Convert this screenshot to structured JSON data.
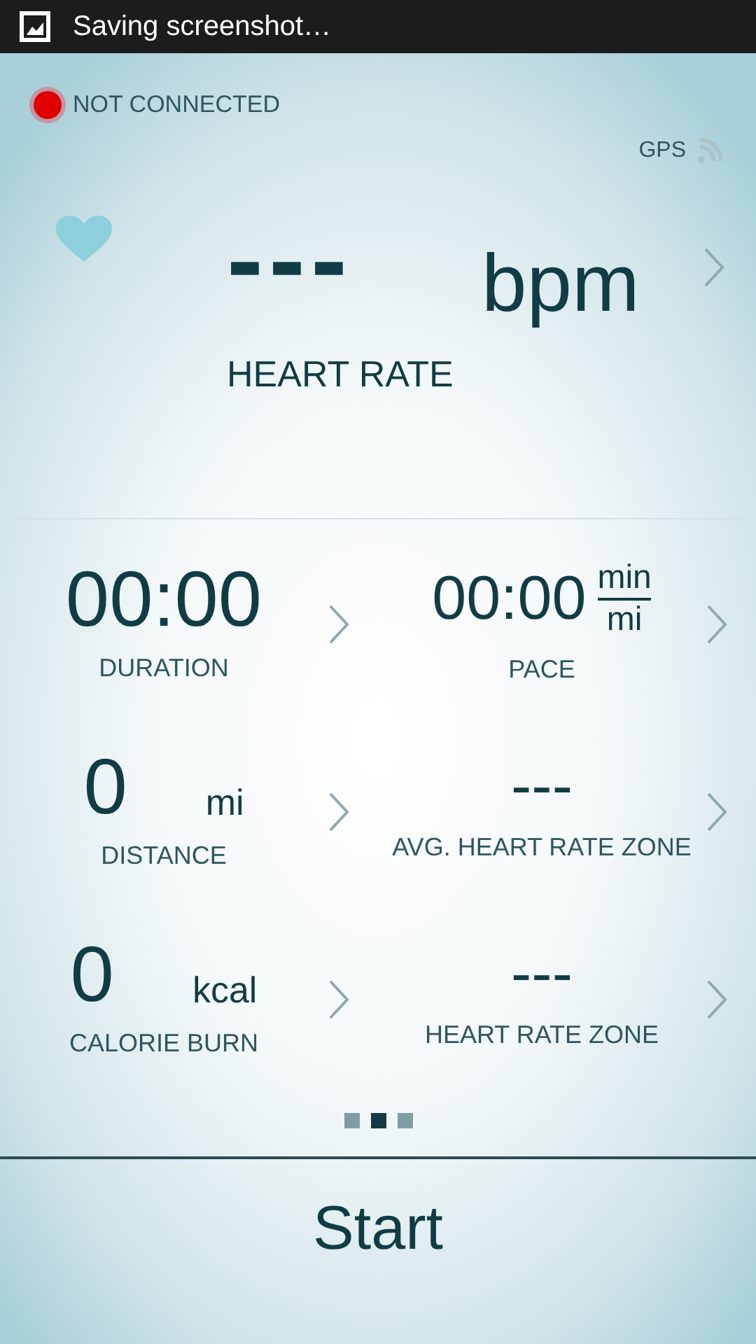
{
  "status_bar": {
    "notification": "Saving screenshot…"
  },
  "connection": {
    "label": "NOT CONNECTED",
    "connected": false
  },
  "gps": {
    "label": "GPS"
  },
  "heart_rate": {
    "value": "---",
    "unit": "bpm",
    "label": "HEART RATE"
  },
  "metrics": [
    {
      "kind": "plain",
      "value": "00:00",
      "label": "DURATION"
    },
    {
      "kind": "fraction",
      "value": "00:00",
      "unit_top": "min",
      "unit_bottom": "mi",
      "label": "PACE"
    },
    {
      "kind": "unit",
      "value": "0",
      "unit": "mi",
      "label": "DISTANCE"
    },
    {
      "kind": "plain",
      "value": "---",
      "label": "AVG. HEART RATE ZONE"
    },
    {
      "kind": "unit",
      "value": "0",
      "unit": "kcal",
      "label": "CALORIE BURN"
    },
    {
      "kind": "plain",
      "value": "---",
      "label": "HEART RATE ZONE"
    }
  ],
  "pager": [
    {
      "selected": false
    },
    {
      "selected": true
    },
    {
      "selected": false
    }
  ],
  "start_button": {
    "label": "Start"
  }
}
